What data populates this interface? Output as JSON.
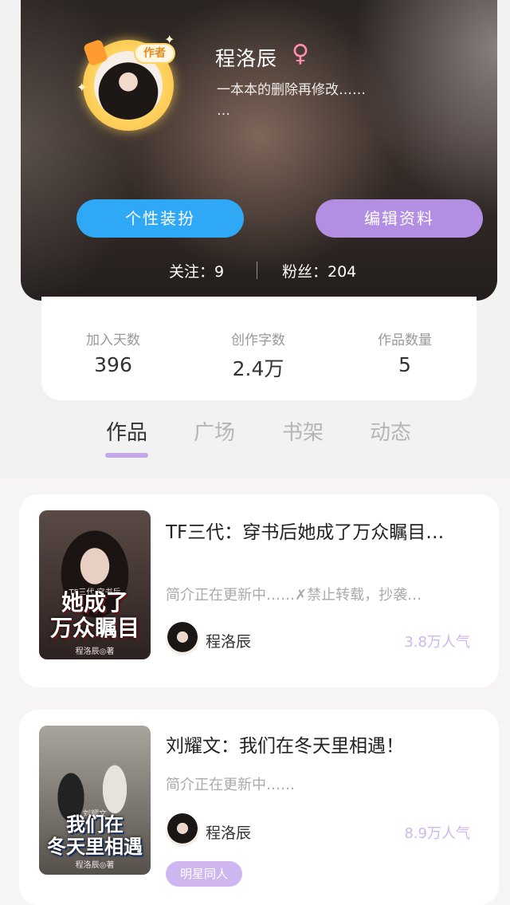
{
  "profile": {
    "name": "程洛辰",
    "gender_symbol": "♀",
    "bio": "一本本的删除再修改……\n…",
    "author_badge": "作者",
    "buttons": {
      "dress_up": "个性装扮",
      "edit_profile": "编辑资料"
    },
    "follow_text": "关注：9",
    "fans_text": "粉丝：204"
  },
  "stats": [
    {
      "label": "加入天数",
      "value": "396"
    },
    {
      "label": "创作字数",
      "value": "2.4万"
    },
    {
      "label": "作品数量",
      "value": "5"
    }
  ],
  "tabs": [
    {
      "label": "作品",
      "active": true
    },
    {
      "label": "广场",
      "active": false
    },
    {
      "label": "书架",
      "active": false
    },
    {
      "label": "动态",
      "active": false
    }
  ],
  "works": [
    {
      "title": "TF三代：穿书后她成了万众瞩目…",
      "intro": "简介正在更新中……✗禁止转载，抄袭…",
      "author": "程洛辰",
      "popularity": "3.8万人气",
      "cover_title": "她成了\n万众瞩目",
      "cover_top_text": "TF三代·穿书后",
      "cover_author": "程洛辰◎著"
    },
    {
      "title": "刘耀文：我们在冬天里相遇！",
      "intro": "简介正在更新中……",
      "author": "程洛辰",
      "popularity": "8.9万人气",
      "cover_title": "我们在\n冬天里相遇",
      "cover_top_text": "刘耀文",
      "cover_author": "程洛辰◎著",
      "tag": "明星同人"
    }
  ],
  "colors": {
    "dress_button": "#2fa8f6",
    "edit_button": "#b38fe3",
    "active_tab_underline": "#c3a8e9",
    "popularity": "#cdb7ee",
    "tag": "#cfb6ee"
  }
}
